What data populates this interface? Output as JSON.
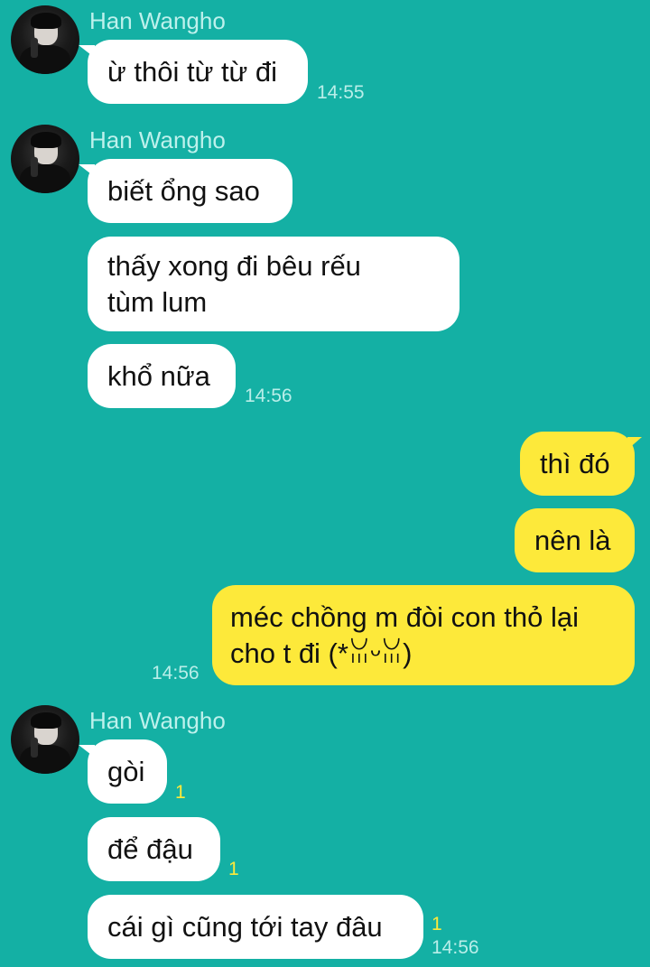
{
  "contact": {
    "name": "Han Wangho"
  },
  "groups": [
    {
      "sender": "Han Wangho",
      "messages": [
        {
          "text": "ừ thôi từ từ đi"
        }
      ],
      "time": "14:55"
    },
    {
      "sender": "Han Wangho",
      "messages": [
        {
          "text": "biết ổng sao"
        },
        {
          "lines": [
            "thấy xong đi bêu rếu",
            "tùm lum"
          ]
        },
        {
          "text": "khổ nữa"
        }
      ],
      "time": "14:56"
    },
    {
      "sender": "me",
      "messages": [
        {
          "text": "thì đó"
        },
        {
          "text": "nên là"
        },
        {
          "lines": [
            "méc chồng m đòi con thỏ lại",
            "cho t đi (*ꈍᵕꈍ)"
          ]
        }
      ],
      "time": "14:56"
    },
    {
      "sender": "Han Wangho",
      "messages": [
        {
          "text": "gòi",
          "unread": "1"
        },
        {
          "text": "để đậu",
          "unread": "1"
        },
        {
          "text": "cái gì cũng tới tay đâu",
          "unread": "1"
        }
      ],
      "time": "14:56"
    }
  ],
  "colors": {
    "background": "#14b0a4",
    "incoming_bubble": "#ffffff",
    "outgoing_bubble": "#fde93a",
    "name_text": "#bdf1ec",
    "unread_count": "#fde93a"
  },
  "icons": {
    "avatar": "profile-photo-avatar"
  }
}
